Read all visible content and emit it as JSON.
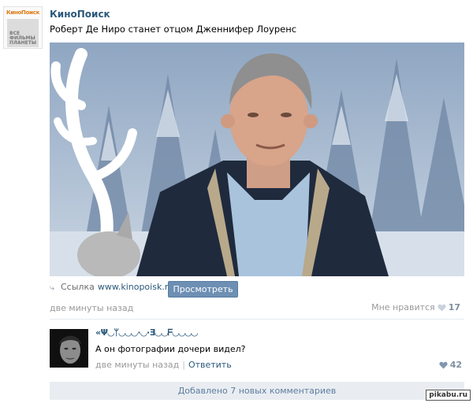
{
  "group": {
    "avatar_top": "КиноПоиск",
    "avatar_bottom": "ВСЕ\nФИЛЬМЫ\nПЛАНЕТЫ",
    "name": "КиноПоиск"
  },
  "post": {
    "text": "Роберт Де Ниро станет отцом Дженнифер Лоуренс",
    "link_label": "Ссылка",
    "link_url": "www.kinopoisk.ru",
    "view_button": "Просмотреть",
    "time": "две минуты назад",
    "like_label": "Мне нравится",
    "like_count": "17"
  },
  "comment": {
    "author": "«Ψ◡ᛘ◡◡◡·◡·Ǝ◡◡ᖴ◡◡◡◡",
    "text": "А он фотографии дочери видел?",
    "time": "две минуты назад",
    "reply": "Ответить",
    "like_count": "42"
  },
  "more_comments": "Добавлено 7 новых комментариев",
  "watermark": "pikabu.ru",
  "colors": {
    "link": "#2b587a",
    "button": "#6d8fb3",
    "muted": "#999999",
    "bar": "#e9edf1"
  }
}
